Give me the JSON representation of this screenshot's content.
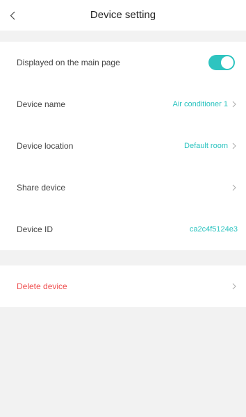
{
  "header": {
    "title": "Device setting",
    "back_icon": "chevron-left-icon"
  },
  "settings": {
    "display_main": {
      "label": "Displayed on the main page",
      "toggle_on": true,
      "toggle_color": "#2ec4c0"
    },
    "device_name": {
      "label": "Device name",
      "value": "Air conditioner 1"
    },
    "device_location": {
      "label": "Device location",
      "value": "Default room"
    },
    "share_device": {
      "label": "Share device"
    },
    "device_id": {
      "label": "Device ID",
      "value": "ca2c4f5124e3"
    }
  },
  "danger": {
    "delete_label": "Delete device",
    "color": "#ef4f4f"
  },
  "colors": {
    "accent": "#29c3bf",
    "background": "#f2f2f2"
  }
}
